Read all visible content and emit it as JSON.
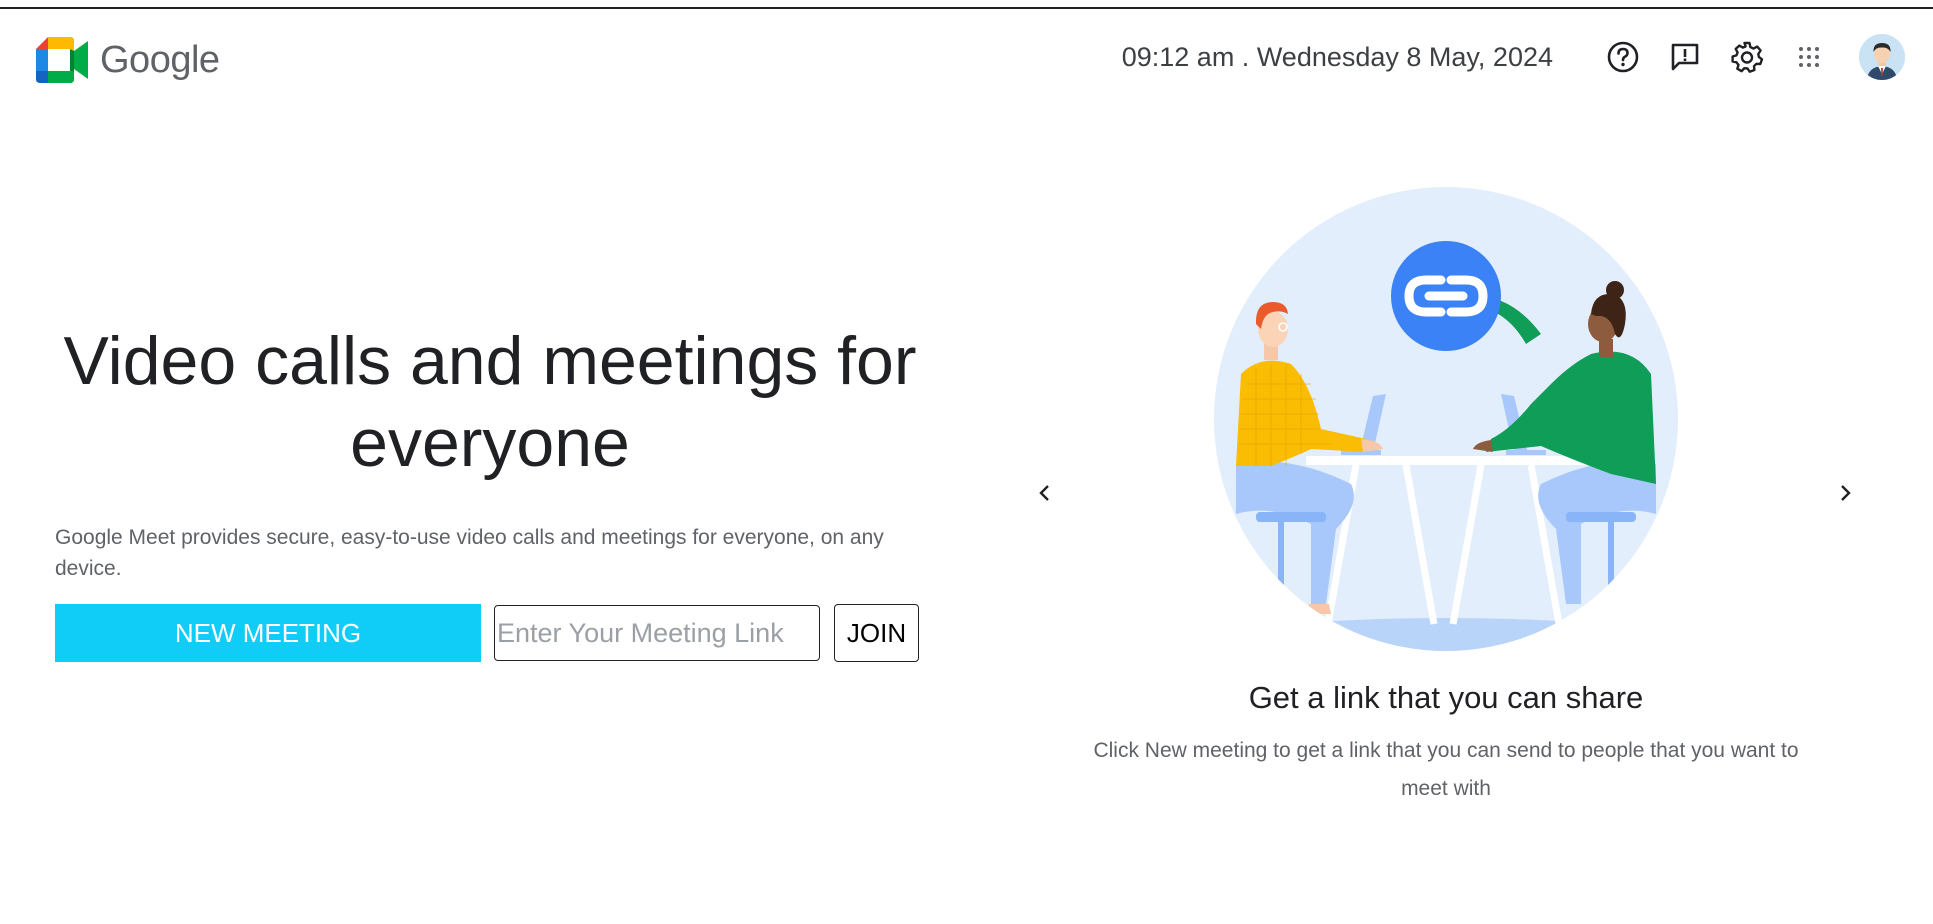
{
  "header": {
    "logo_text": "Google",
    "datetime": "09:12 am . Wednesday 8 May, 2024",
    "icons": [
      "help-icon",
      "feedback-icon",
      "settings-icon",
      "apps-icon",
      "avatar"
    ]
  },
  "hero": {
    "headline": "Video calls and meetings for everyone",
    "description": "Google Meet provides secure, easy-to-use video calls and meetings for everyone, on any device.",
    "new_meeting_label": "NEW MEETING",
    "link_placeholder": "Enter Your Meeting Link",
    "join_label": "JOIN"
  },
  "carousel": {
    "slide_title": "Get a link that you can share",
    "slide_description": "Click New meeting to get a link that you can send to people that you want to meet with"
  },
  "colors": {
    "accent": "#10cdf7",
    "link_circle": "#3b82f6",
    "illustration_bg": "#e3eefd"
  }
}
